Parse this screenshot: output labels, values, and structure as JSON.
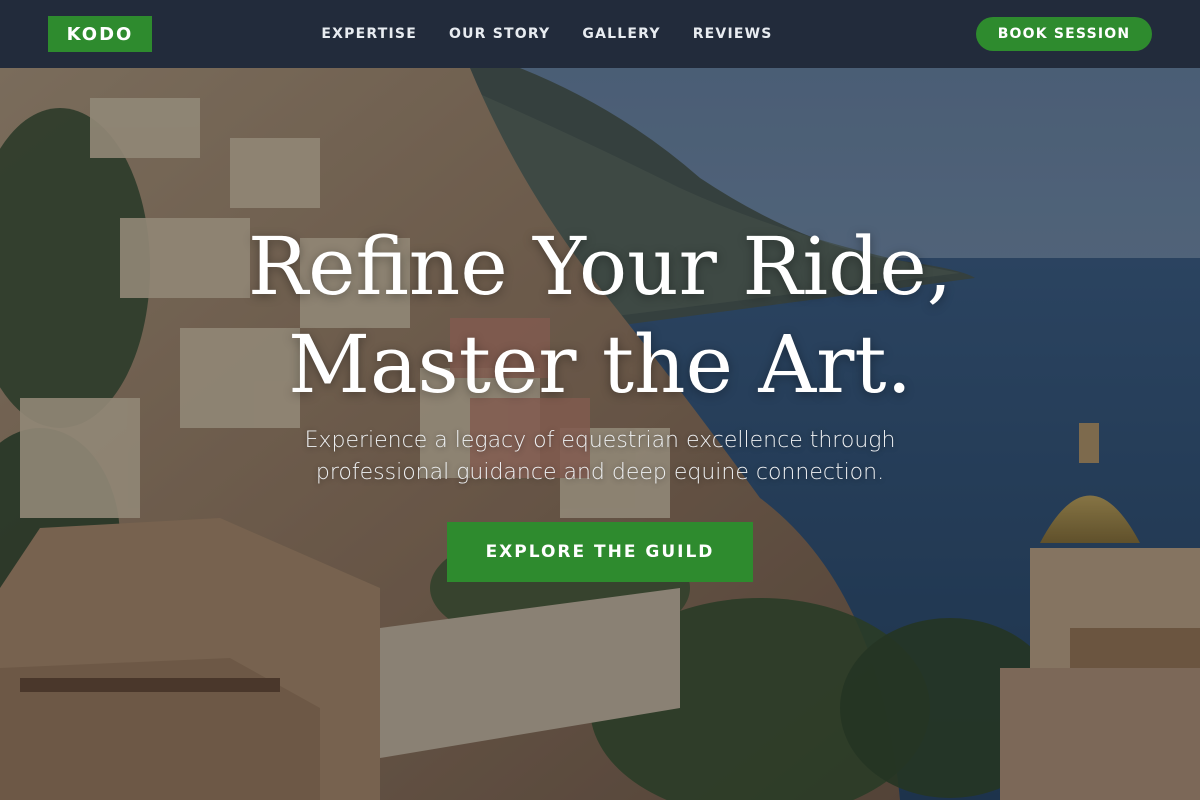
{
  "brand": {
    "name": "KODO",
    "accent_color": "#2e8b2e"
  },
  "nav": {
    "links": [
      {
        "label": "EXPERTISE"
      },
      {
        "label": "OUR STORY"
      },
      {
        "label": "GALLERY"
      },
      {
        "label": "REVIEWS"
      }
    ],
    "cta_label": "BOOK SESSION"
  },
  "hero": {
    "title_lines": [
      "Refine Your Ride,",
      "Master the Art."
    ],
    "subtitle_lines": [
      "Experience a legacy of equestrian excellence through",
      "professional guidance and deep equine connection."
    ],
    "cta_label": "EXPLORE THE GUILD"
  }
}
